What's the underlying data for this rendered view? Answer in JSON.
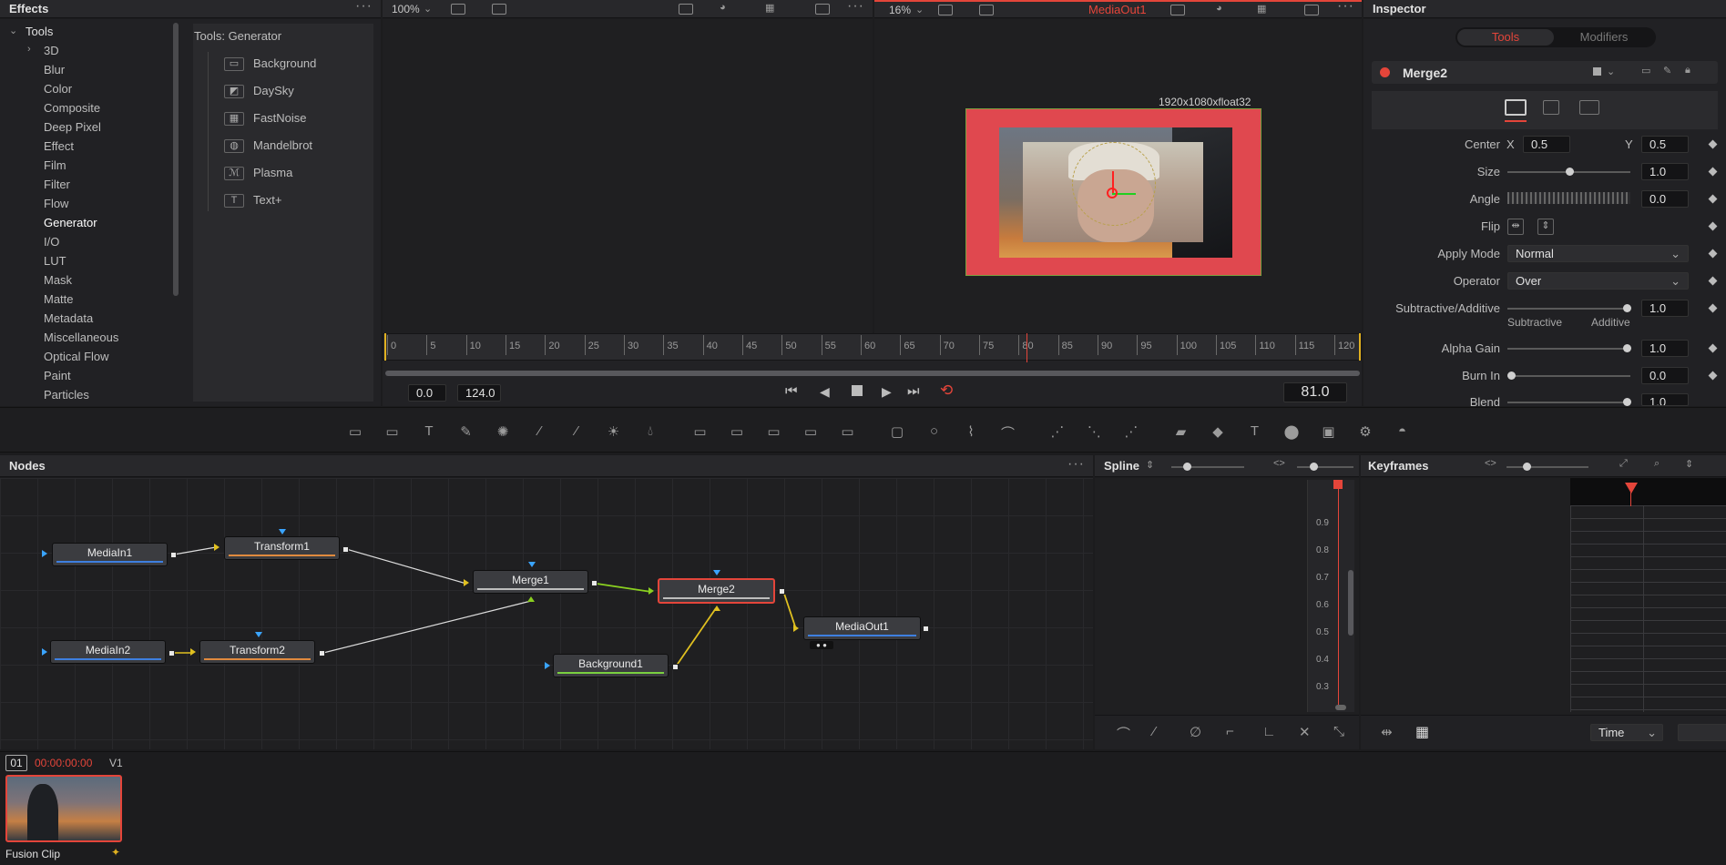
{
  "effects": {
    "title": "Effects",
    "tree_root": "Tools",
    "tree_items": [
      "3D",
      "Blur",
      "Color",
      "Composite",
      "Deep Pixel",
      "Effect",
      "Film",
      "Filter",
      "Flow",
      "Generator",
      "I/O",
      "LUT",
      "Mask",
      "Matte",
      "Metadata",
      "Miscellaneous",
      "Optical Flow",
      "Paint",
      "Particles"
    ],
    "selected_item": "Generator",
    "generator_header": "Tools: Generator",
    "generator_items": [
      "Background",
      "DaySky",
      "FastNoise",
      "Mandelbrot",
      "Plasma",
      "Text+"
    ]
  },
  "viewer_left": {
    "zoom": "100%"
  },
  "viewer_right": {
    "zoom": "16%",
    "title": "MediaOut1",
    "resolution": "1920x1080xfloat32"
  },
  "timeline": {
    "ticks": [
      "0",
      "5",
      "10",
      "15",
      "20",
      "25",
      "30",
      "35",
      "40",
      "45",
      "50",
      "55",
      "60",
      "65",
      "70",
      "75",
      "80",
      "85",
      "90",
      "95",
      "100",
      "105",
      "110",
      "115",
      "120"
    ],
    "start": "0.0",
    "end": "124.0",
    "current": "81.0",
    "playhead_frame": 81,
    "max_frame": 124
  },
  "inspector": {
    "title": "Inspector",
    "tabs": [
      "Tools",
      "Modifiers"
    ],
    "active_tab": "Tools",
    "node_name": "Merge2",
    "center_label": "Center",
    "x_label": "X",
    "x_value": "0.5",
    "y_label": "Y",
    "y_value": "0.5",
    "size_label": "Size",
    "size_value": "1.0",
    "angle_label": "Angle",
    "angle_value": "0.0",
    "flip_label": "Flip",
    "apply_mode_label": "Apply Mode",
    "apply_mode_value": "Normal",
    "operator_label": "Operator",
    "operator_value": "Over",
    "sub_add_label": "Subtractive/Additive",
    "sub_add_value": "1.0",
    "subtractive": "Subtractive",
    "additive": "Additive",
    "alpha_gain_label": "Alpha Gain",
    "alpha_gain_value": "1.0",
    "burn_in_label": "Burn In",
    "burn_in_value": "0.0",
    "blend_label": "Blend",
    "blend_value": "1.0"
  },
  "nodes": {
    "title": "Nodes",
    "items": {
      "mediain1": "MediaIn1",
      "transform1": "Transform1",
      "merge1": "Merge1",
      "merge2": "Merge2",
      "mediaout1": "MediaOut1",
      "mediain2": "MediaIn2",
      "transform2": "Transform2",
      "background1": "Background1"
    }
  },
  "spline": {
    "title": "Spline",
    "axis": [
      "0.9",
      "0.8",
      "0.7",
      "0.6",
      "0.5",
      "0.4",
      "0.3"
    ]
  },
  "keyframes": {
    "title": "Keyframes",
    "mode": "Time"
  },
  "clips": {
    "track_num": "01",
    "timecode": "00:00:00:00",
    "track": "V1",
    "clip_name": "Fusion Clip"
  },
  "colors": {
    "accent_red": "#e4453a",
    "bg": "#1c1c1e",
    "panel": "#212124"
  }
}
